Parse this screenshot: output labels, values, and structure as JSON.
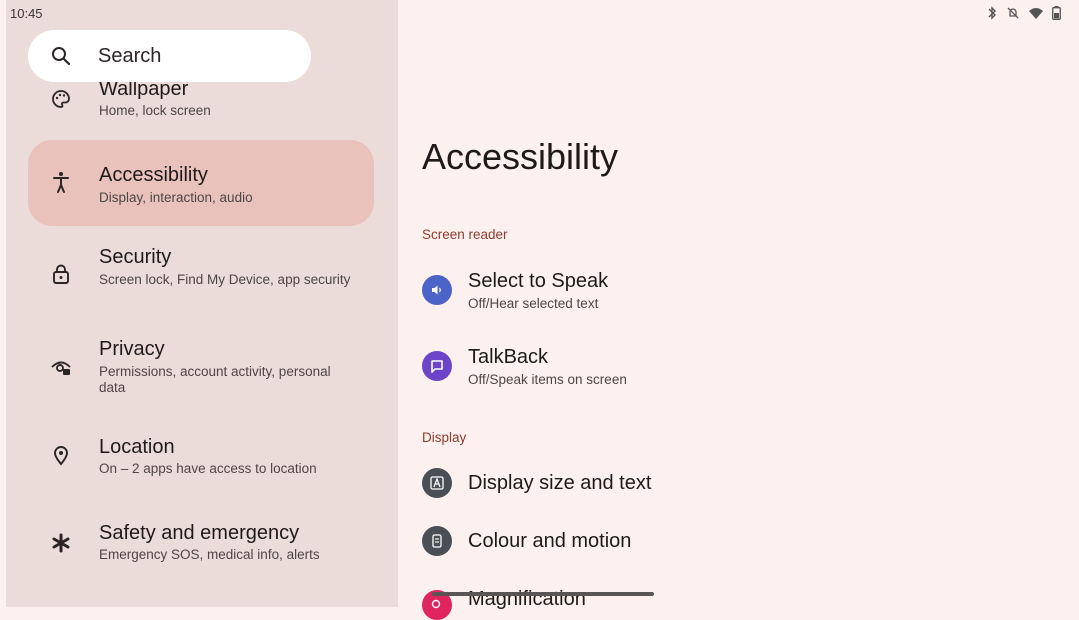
{
  "status_bar": {
    "time": "10:45",
    "icons": [
      "bluetooth-icon",
      "mute-icon",
      "wifi-icon",
      "battery-icon"
    ]
  },
  "sidebar": {
    "search_label": "Search",
    "items": [
      {
        "title": "Wallpaper",
        "subtitle": "Home, lock screen",
        "icon": "palette-icon"
      },
      {
        "title": "Accessibility",
        "subtitle": "Display, interaction, audio",
        "icon": "accessibility-icon",
        "active": true
      },
      {
        "title": "Security",
        "subtitle": "Screen lock, Find My Device, app security",
        "icon": "lock-icon"
      },
      {
        "title": "Privacy",
        "subtitle": "Permissions, account activity, personal data",
        "icon": "privacy-eye-icon"
      },
      {
        "title": "Location",
        "subtitle": "On – 2 apps have access to location",
        "icon": "location-pin-icon"
      },
      {
        "title": "Safety and emergency",
        "subtitle": "Emergency SOS, medical info, alerts",
        "icon": "asterisk-icon"
      }
    ]
  },
  "main": {
    "title": "Accessibility",
    "sections": [
      {
        "header": "Screen reader",
        "items": [
          {
            "title": "Select to Speak",
            "subtitle": "Off/Hear selected text",
            "icon": "speaker-icon",
            "color": "#4c63c8"
          },
          {
            "title": "TalkBack",
            "subtitle": "Off/Speak items on screen",
            "icon": "chat-bubble-icon",
            "color": "#6d44c9"
          }
        ]
      },
      {
        "header": "Display",
        "items": [
          {
            "title": "Display size and text",
            "icon": "text-size-icon",
            "color": "#4a4f55"
          },
          {
            "title": "Colour and motion",
            "icon": "color-motion-icon",
            "color": "#4a4f55"
          },
          {
            "title": "Magnification",
            "icon": "magnify-icon",
            "color": "#e0245e"
          }
        ]
      }
    ]
  }
}
